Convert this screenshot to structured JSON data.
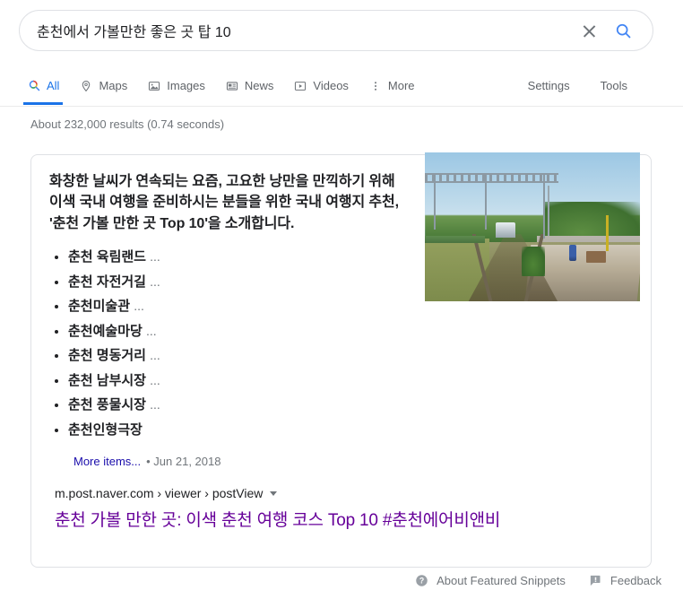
{
  "search": {
    "query": "춘천에서 가볼만한 좋은 곳 탑 10",
    "placeholder": "Search",
    "clear_icon": "close-x-icon",
    "search_icon": "magnifier-icon",
    "accent_color": "#4285f4"
  },
  "nav": {
    "tabs": [
      {
        "label": "All",
        "icon": "magnifier-icon",
        "active": true
      },
      {
        "label": "Maps",
        "icon": "map-pin-icon",
        "active": false
      },
      {
        "label": "Images",
        "icon": "image-icon",
        "active": false
      },
      {
        "label": "News",
        "icon": "newspaper-icon",
        "active": false
      },
      {
        "label": "Videos",
        "icon": "video-play-icon",
        "active": false
      },
      {
        "label": "More",
        "icon": "kebab-menu-icon",
        "active": false
      }
    ],
    "right_links": [
      {
        "label": "Settings"
      },
      {
        "label": "Tools"
      }
    ],
    "active_color": "#1a73e8"
  },
  "results": {
    "stats": "About 232,000 results (0.74 seconds)"
  },
  "snippet": {
    "paragraph": "화창한 날씨가 연속되는 요즘, 고요한 낭만을 만끽하기 위해 이색 국내 여행을 준비하시는 분들을 위한 국내 여행지 추천, '춘천 가볼 만한 곳 Top 10'을 소개합니다.",
    "items": [
      {
        "text": "춘천 육림랜드",
        "ellipsis": "..."
      },
      {
        "text": "춘천 자전거길",
        "ellipsis": "..."
      },
      {
        "text": "춘천미술관",
        "ellipsis": "..."
      },
      {
        "text": "춘천예술마당",
        "ellipsis": "..."
      },
      {
        "text": "춘천 명동거리",
        "ellipsis": "..."
      },
      {
        "text": "춘천 남부시장",
        "ellipsis": "..."
      },
      {
        "text": "춘천 풍물시장",
        "ellipsis": "..."
      },
      {
        "text": "춘천인형극장",
        "ellipsis": ""
      }
    ],
    "more_items_label": "More items...",
    "date": "• Jun 21, 2018",
    "source_url": "m.post.naver.com › viewer › postView",
    "title": "춘천 가볼 만한 곳: 이색 춘천 여행 코스 Top 10 #춘천에어비앤비",
    "title_color": "#660099",
    "link_color": "#1a0dab",
    "thumbnail_alt": "railway-track-photo"
  },
  "footer": {
    "about_label": "About Featured Snippets",
    "about_icon": "question-circle-icon",
    "feedback_label": "Feedback",
    "feedback_icon": "feedback-flag-icon"
  }
}
